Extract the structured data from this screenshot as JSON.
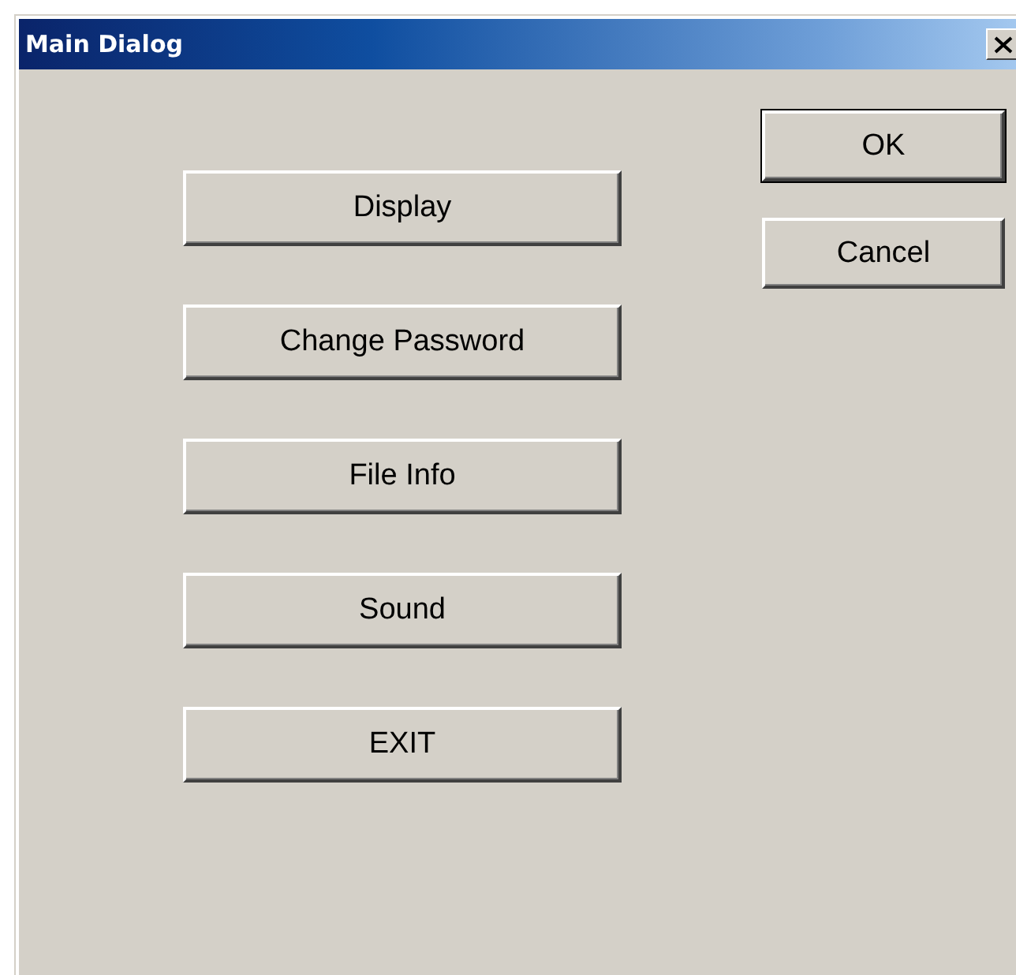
{
  "window": {
    "title": "Main Dialog"
  },
  "menu_buttons": [
    {
      "label": "Display"
    },
    {
      "label": "Change Password"
    },
    {
      "label": "File Info"
    },
    {
      "label": "Sound"
    },
    {
      "label": "EXIT"
    }
  ],
  "dialog_buttons": [
    {
      "label": "OK",
      "default": true
    },
    {
      "label": "Cancel",
      "default": false
    }
  ]
}
